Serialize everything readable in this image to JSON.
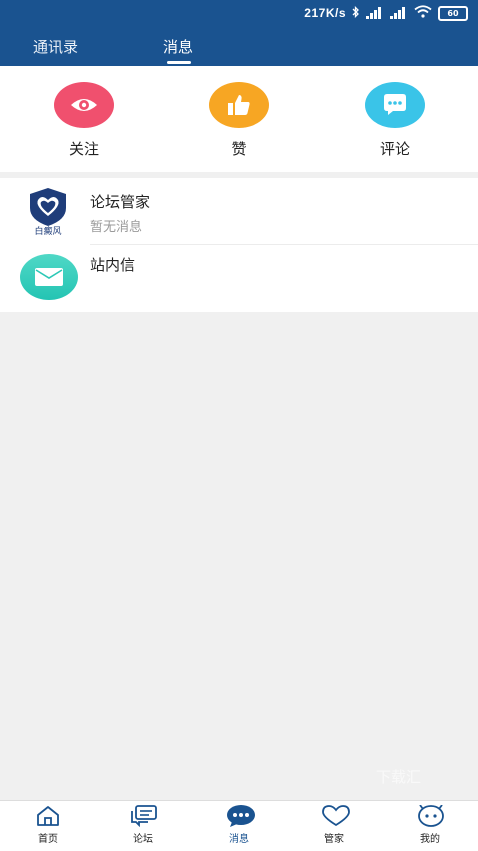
{
  "status": {
    "speed": "217K/s",
    "battery": "60"
  },
  "tabs": {
    "contacts": "通讯录",
    "messages": "消息"
  },
  "quick_actions": [
    {
      "label": "关注",
      "icon": "eye-icon",
      "color": "#f0506e"
    },
    {
      "label": "赞",
      "icon": "thumbs-up-icon",
      "color": "#f7a623"
    },
    {
      "label": "评论",
      "icon": "chat-bubble-icon",
      "color": "#3ac4e8"
    }
  ],
  "messages": [
    {
      "title": "论坛管家",
      "subtitle": "暂无消息",
      "logo_text": "白癜风"
    },
    {
      "title": "站内信",
      "icon": "mail-icon"
    }
  ],
  "watermark": "下载汇",
  "bottom_nav": [
    {
      "label": "首页",
      "icon": "home-icon"
    },
    {
      "label": "论坛",
      "icon": "forum-icon"
    },
    {
      "label": "消息",
      "icon": "message-icon",
      "active": true
    },
    {
      "label": "管家",
      "icon": "heart-icon"
    },
    {
      "label": "我的",
      "icon": "profile-icon"
    }
  ],
  "colors": {
    "header": "#1a5390",
    "background": "#f0f0f0",
    "active": "#1a5390"
  }
}
